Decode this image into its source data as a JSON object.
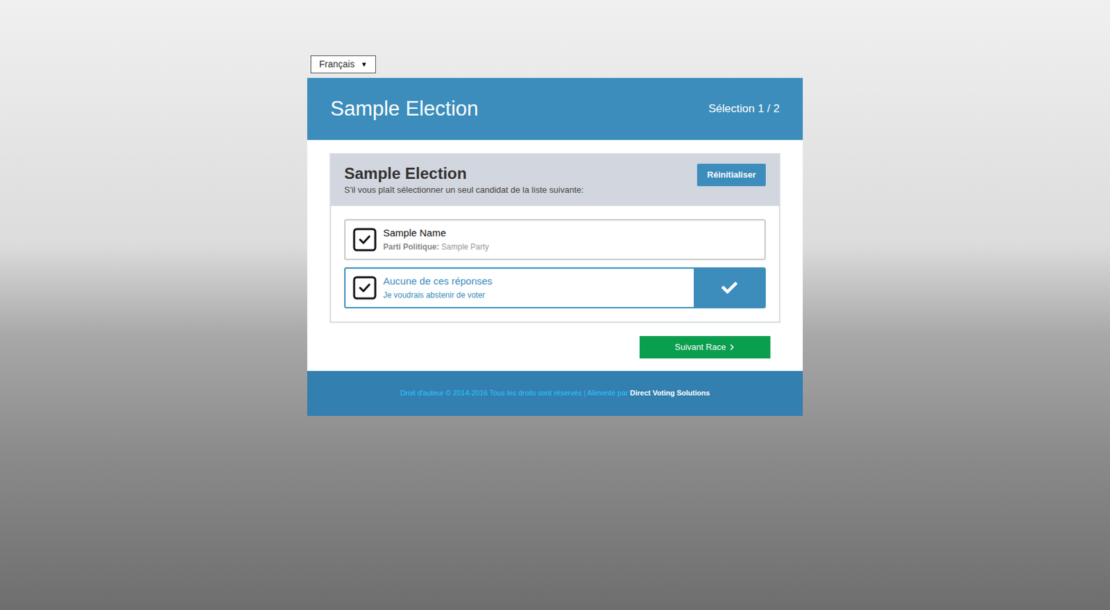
{
  "language_select": {
    "value": "Français"
  },
  "header": {
    "title": "Sample Election",
    "progress": "Sélection 1 / 2"
  },
  "race": {
    "title": "Sample Election",
    "instruction": "S'il vous plaît sélectionner un seul candidat de la liste suivante:",
    "reset_button": "Réinitialiser"
  },
  "options": [
    {
      "name": "Sample Name",
      "detail_label": "Parti Politique:",
      "detail": "Sample Party",
      "selected": false
    },
    {
      "name": "Aucune de ces réponses",
      "detail_label": "",
      "detail": "Je voudrais abstenir de voter",
      "selected": true
    }
  ],
  "next_button": "Suivant Race",
  "footer": {
    "text": "Droit d'auteur © 2014-2016 Tous les droits sont réservés | Alimenté par",
    "brand": "Direct Voting Solutions"
  }
}
